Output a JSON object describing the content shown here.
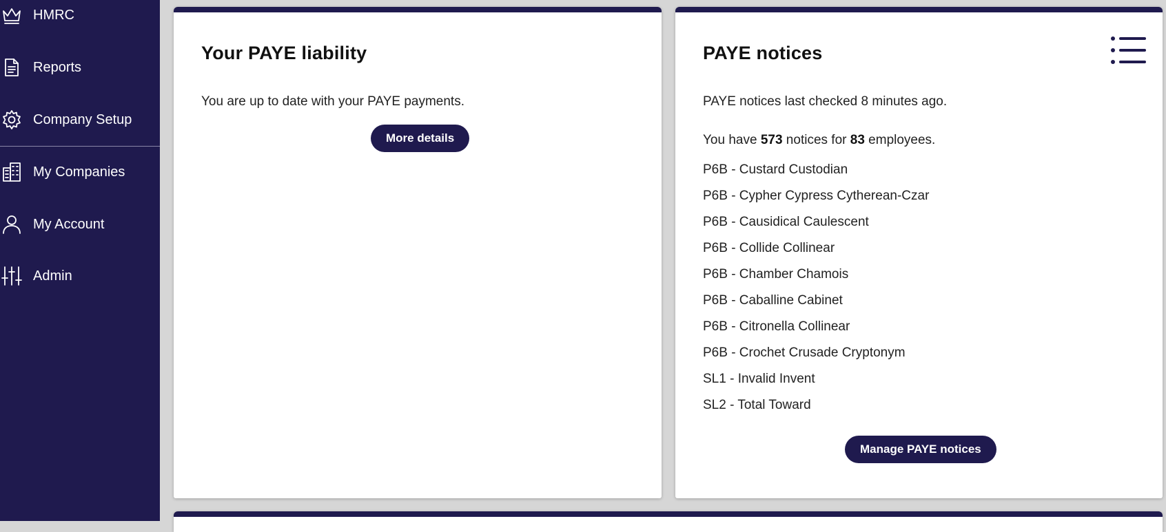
{
  "sidebar": {
    "items": [
      {
        "label": "HMRC",
        "icon": "crown-icon"
      },
      {
        "label": "Reports",
        "icon": "document-icon"
      },
      {
        "label": "Company Setup",
        "icon": "gear-icon"
      },
      {
        "label": "My Companies",
        "icon": "buildings-icon"
      },
      {
        "label": "My Account",
        "icon": "user-icon"
      },
      {
        "label": "Admin",
        "icon": "sliders-icon"
      }
    ]
  },
  "liability_card": {
    "title": "Your PAYE liability",
    "status": "You are up to date with your PAYE payments.",
    "button": "More details"
  },
  "notices_card": {
    "title": "PAYE notices",
    "last_checked": "PAYE notices last checked 8 minutes ago.",
    "summary_prefix": "You have ",
    "notice_count": "573",
    "summary_middle": " notices for ",
    "employee_count": "83",
    "summary_suffix": " employees.",
    "notices": [
      "P6B - Custard Custodian",
      "P6B - Cypher Cypress Cytherean-Czar",
      "P6B - Causidical Caulescent",
      "P6B - Collide Collinear",
      "P6B - Chamber Chamois",
      "P6B - Caballine Cabinet",
      "P6B - Citronella Collinear",
      "P6B - Crochet Crusade Cryptonym",
      "SL1 - Invalid Invent",
      "SL2 - Total Toward"
    ],
    "button": "Manage PAYE notices"
  },
  "colors": {
    "brand": "#1f1a4e",
    "background": "#d6d6d6"
  }
}
